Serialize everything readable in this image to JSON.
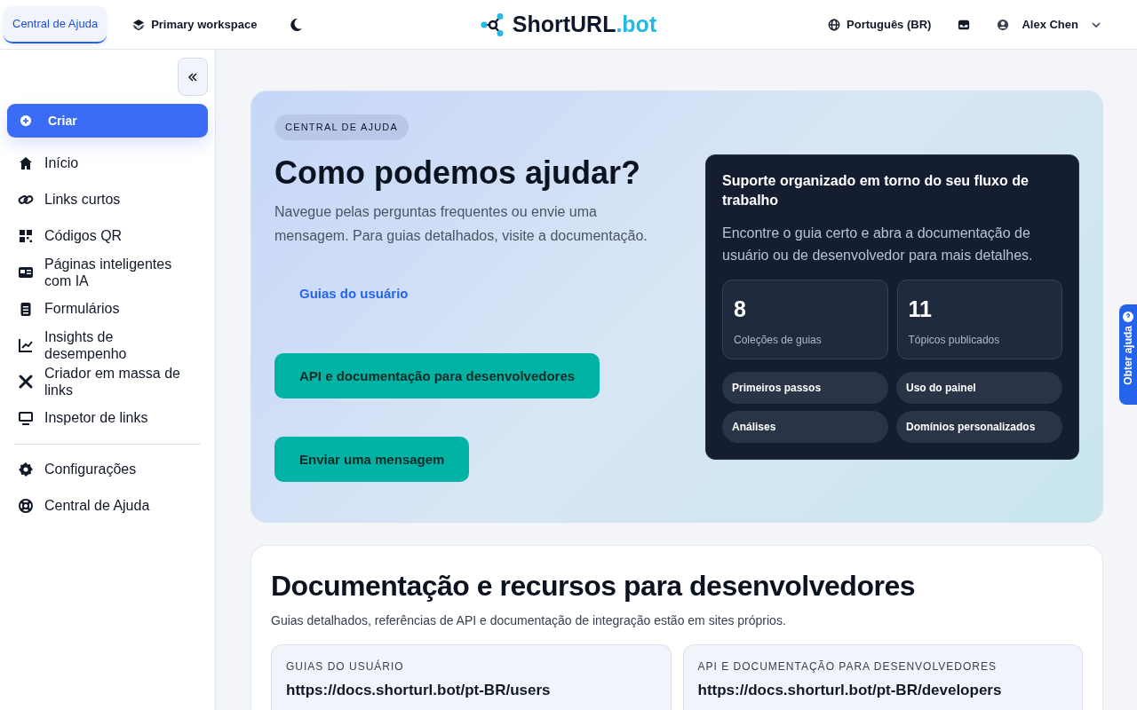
{
  "header": {
    "tabs": [
      {
        "label": "Central de Ajuda",
        "selected": true
      }
    ],
    "workspace": "Primary workspace",
    "logo": {
      "name": "ShortURL",
      "suffix": ".bot"
    },
    "language": "Português (BR)",
    "user": "Alex Chen"
  },
  "sidebar": {
    "create": "Criar",
    "items": [
      {
        "label": "Início"
      },
      {
        "label": "Links curtos"
      },
      {
        "label": "Códigos QR"
      },
      {
        "label": "Páginas inteligentes com IA"
      },
      {
        "label": "Formulários"
      },
      {
        "label": "Insights de desempenho"
      },
      {
        "label": "Criador em massa de links"
      },
      {
        "label": "Inspetor de links"
      }
    ],
    "footer_items": [
      {
        "label": "Configurações"
      },
      {
        "label": "Central de Ajuda"
      }
    ]
  },
  "hero": {
    "badge": "CENTRAL DE AJUDA",
    "title": "Como podemos ajudar?",
    "text": "Navegue pelas perguntas frequentes ou envie uma mensagem. Para guias detalhados, visite a documentação.",
    "actions": [
      {
        "kind": "link",
        "label": "Guias do usuário"
      },
      {
        "kind": "button",
        "label": "API e documentação para desenvolvedores"
      },
      {
        "kind": "button",
        "label": "Enviar uma mensagem"
      }
    ],
    "panel": {
      "title": "Suporte organizado em torno do seu fluxo de trabalho",
      "text": "Encontre o guia certo e abra a documentação de usuário ou de desenvolvedor para mais detalhes.",
      "stats": [
        {
          "value": "8",
          "label": "Coleções de guias"
        },
        {
          "value": "11",
          "label": "Tópicos publicados"
        }
      ],
      "topics": [
        "Primeiros passos",
        "Uso do painel",
        "Análises",
        "Domínios personalizados"
      ]
    }
  },
  "docs": {
    "title": "Documentação e recursos para desenvolvedores",
    "text": "Guias detalhados, referências de API e documentação de integração estão em sites próprios.",
    "cards": [
      {
        "label": "GUIAS DO USUÁRIO",
        "url": "https://docs.shorturl.bot/pt-BR/users"
      },
      {
        "label": "API E DOCUMENTAÇÃO PARA DESENVOLVEDORES",
        "url": "https://docs.shorturl.bot/pt-BR/developers"
      }
    ]
  },
  "help_tab": "Obter ajuda"
}
